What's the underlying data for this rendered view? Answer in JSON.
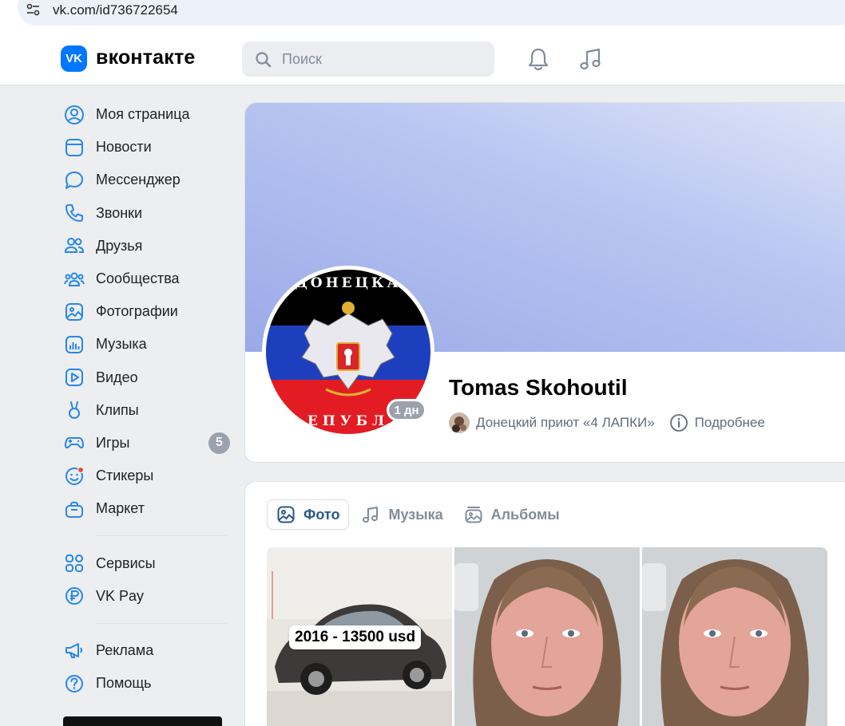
{
  "browser": {
    "url": "vk.com/id736722654"
  },
  "header": {
    "logo_text": "вконтакте",
    "logo_mark": "VK",
    "search_placeholder": "Поиск"
  },
  "sidebar": {
    "items": [
      {
        "label": "Моя страница",
        "icon": "user-circle-icon"
      },
      {
        "label": "Новости",
        "icon": "news-icon"
      },
      {
        "label": "Мессенджер",
        "icon": "message-icon"
      },
      {
        "label": "Звонки",
        "icon": "phone-icon"
      },
      {
        "label": "Друзья",
        "icon": "friends-icon"
      },
      {
        "label": "Сообщества",
        "icon": "communities-icon"
      },
      {
        "label": "Фотографии",
        "icon": "photo-icon"
      },
      {
        "label": "Музыка",
        "icon": "music-icon"
      },
      {
        "label": "Видео",
        "icon": "video-icon"
      },
      {
        "label": "Клипы",
        "icon": "clips-icon"
      },
      {
        "label": "Игры",
        "icon": "games-icon",
        "badge": "5"
      },
      {
        "label": "Стикеры",
        "icon": "stickers-icon"
      },
      {
        "label": "Маркет",
        "icon": "market-icon"
      }
    ],
    "group2": [
      {
        "label": "Сервисы",
        "icon": "services-icon"
      },
      {
        "label": "VK Pay",
        "icon": "vkpay-icon"
      }
    ],
    "group3": [
      {
        "label": "Реклама",
        "icon": "ads-icon"
      },
      {
        "label": "Помощь",
        "icon": "help-icon"
      }
    ]
  },
  "profile": {
    "name": "Tomas Skohoutil",
    "online": "1 дн",
    "group": "Донецкий приют «4 ЛАПКИ»",
    "more": "Подробнее",
    "avatar_text_top": "ДОНЕЦКА",
    "avatar_text_bottom": "ЕПУБЛ"
  },
  "media": {
    "tabs": [
      {
        "label": "Фото",
        "icon": "photo-icon",
        "active": true
      },
      {
        "label": "Музыка",
        "icon": "music-note-icon",
        "active": false
      },
      {
        "label": "Альбомы",
        "icon": "albums-icon",
        "active": false
      }
    ],
    "car_caption": "2016 - 13500 usd"
  },
  "colors": {
    "accent": "#0077ff",
    "badge": "#99a2ad",
    "link": "#2a5885"
  }
}
